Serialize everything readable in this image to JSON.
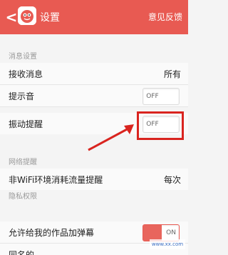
{
  "header": {
    "back_glyph": "<",
    "title": "设置",
    "feedback": "意见反馈"
  },
  "sections": {
    "message": {
      "title": "消息设置"
    },
    "network": {
      "title": "网络提醒"
    },
    "privacy": {
      "title": "隐私权限"
    }
  },
  "rows": {
    "receive": {
      "label": "接收消息",
      "value": "所有"
    },
    "sound": {
      "label": "提示音",
      "toggle": "OFF"
    },
    "vibrate": {
      "label": "振动提醒",
      "toggle": "OFF"
    },
    "wifi": {
      "label": "非WiFi环境消耗流量提醒",
      "value": "每次"
    },
    "danmaku": {
      "label": "允许给我的作品加弹幕",
      "toggle": "ON"
    },
    "partial": {
      "label": "同名的"
    }
  },
  "watermark": {
    "text": "www.xx.com"
  },
  "colors": {
    "accent": "#e85a52",
    "highlight": "#d9241f",
    "background": "#f4f4f4"
  },
  "icons": {
    "back": "chevron-left-icon",
    "app": "app-logo-icon",
    "arrow": "annotation-arrow-icon"
  }
}
